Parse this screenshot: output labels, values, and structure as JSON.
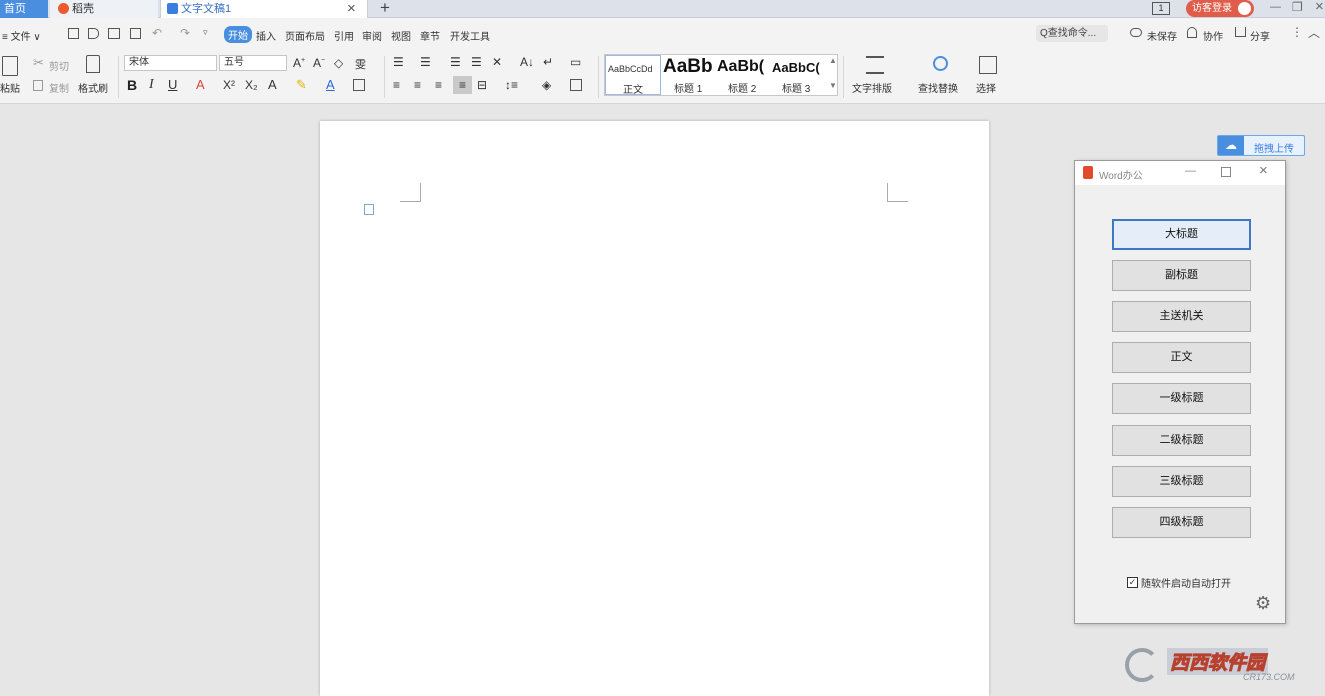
{
  "tabs": {
    "home": "首页",
    "daoke": "稻壳",
    "doc": "文字文稿1",
    "close": "×",
    "add": "+"
  },
  "topright": {
    "page_num": "1",
    "login": "访客登录",
    "minimize": "—",
    "restore": "❐",
    "close": "×"
  },
  "menu": {
    "file": "≡ 文件 ∨",
    "items": [
      "开始",
      "插入",
      "页面布局",
      "引用",
      "审阅",
      "视图",
      "章节",
      "开发工具"
    ],
    "search": "Q查找命令...",
    "unsaved": "未保存",
    "collab": "协作",
    "share": "分享"
  },
  "ribbon": {
    "paste": "粘贴",
    "cut": "剪切",
    "copy": "复制",
    "format_painter": "格式刷",
    "font_name": "宋体",
    "font_size": "五号",
    "bold": "B",
    "italic": "I",
    "underline": "U",
    "superscript": "X²",
    "subscript": "X₂",
    "styles": [
      {
        "preview": "AaBbCcDd",
        "label": "正文"
      },
      {
        "preview": "AaBb",
        "label": "标题 1"
      },
      {
        "preview": "AaBb(",
        "label": "标题 2"
      },
      {
        "preview": "AaBbC(",
        "label": "标题 3"
      }
    ],
    "text_layout": "文字排版",
    "find_replace": "查找替换",
    "select": "选择"
  },
  "upload": {
    "label": "拖拽上传"
  },
  "panel": {
    "title": "Word办公",
    "buttons": [
      "大标题",
      "副标题",
      "主送机关",
      "正文",
      "一级标题",
      "二级标题",
      "三级标题",
      "四级标题"
    ],
    "autostart": "随软件启动自动打开"
  },
  "watermark": {
    "main": "西西软件园",
    "sub": "CR173.COM"
  },
  "colors": {
    "accent": "#4a8ee0",
    "login": "#e05c4b",
    "panel_focus": "#3c78c3"
  }
}
